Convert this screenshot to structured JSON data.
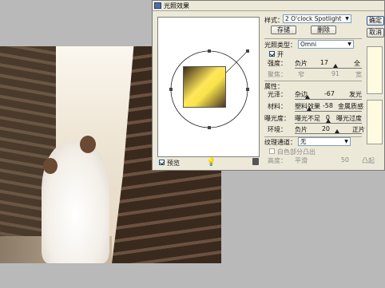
{
  "dialog": {
    "title": "光照效果",
    "preview_label": "预览",
    "buttons": {
      "ok": "确定",
      "cancel": "取消"
    },
    "style": {
      "label": "样式：",
      "value": "2 O'clock Spotlight",
      "save": "存储",
      "delete": "删除"
    },
    "light_type": {
      "label": "光照类型：",
      "value": "Omni",
      "on_label": "开"
    },
    "intensity": {
      "label": "强度：",
      "left": "负片",
      "value": "17",
      "right": "全"
    },
    "focus": {
      "label": "聚焦：",
      "left": "窄",
      "value": "91",
      "right": "宽"
    },
    "properties": {
      "label": "属性：",
      "gloss": {
        "label": "光泽：",
        "left": "杂边",
        "value": "-67",
        "right": "发光"
      },
      "material": {
        "label": "材料：",
        "left": "塑料效果",
        "value": "-58",
        "right": "金属质感"
      },
      "exposure": {
        "label": "曝光度：",
        "left": "曝光不足",
        "value": "0",
        "right": "曝光过度"
      },
      "ambience": {
        "label": "环境：",
        "left": "负片",
        "value": "20",
        "right": "正片"
      }
    },
    "texture": {
      "label": "纹理通道：",
      "value": "无",
      "white_high_label": "白色部分凸出",
      "height_label": "高度：",
      "height_left": "平滑",
      "height_value": "50",
      "height_right": "凸起"
    },
    "state": {
      "preview_checked": true,
      "light_on": true,
      "white_high_checked": false
    }
  },
  "colors": {
    "swatch": "#fffbe0",
    "dialog_bg": "#ece9d8"
  }
}
